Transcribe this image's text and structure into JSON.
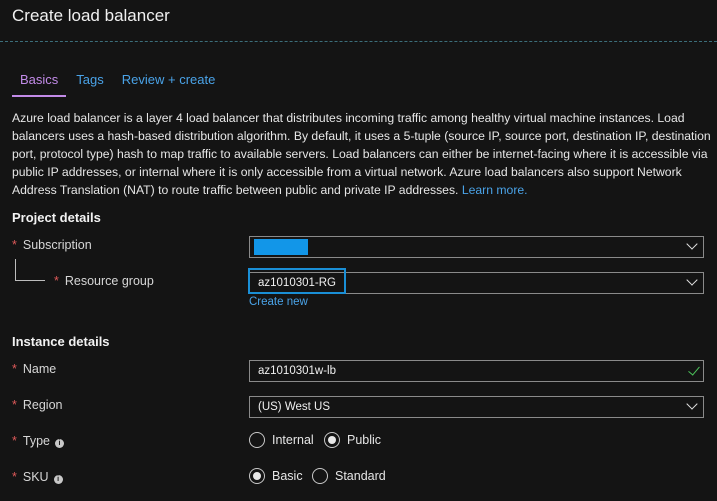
{
  "window": {
    "title": "Create load balancer"
  },
  "tabs": [
    {
      "label": "Basics",
      "active": true
    },
    {
      "label": "Tags",
      "active": false
    },
    {
      "label": "Review + create",
      "active": false
    }
  ],
  "description": {
    "text": "Azure load balancer is a layer 4 load balancer that distributes incoming traffic among healthy virtual machine instances. Load balancers uses a hash-based distribution algorithm. By default, it uses a 5-tuple (source IP, source port, destination IP, destination port, protocol type) hash to map traffic to available servers. Load balancers can either be internet-facing where it is accessible via public IP addresses, or internal where it is only accessible from a virtual network. Azure load balancers also support Network Address Translation (NAT) to route traffic between public and private IP addresses.",
    "link": "Learn more."
  },
  "project_details": {
    "heading": "Project details",
    "subscription": {
      "label": "Subscription",
      "required_mark": "*",
      "value": ""
    },
    "resource_group": {
      "label": "Resource group",
      "required_mark": "*",
      "value": "az1010301-RG",
      "create_new": "Create new"
    }
  },
  "instance_details": {
    "heading": "Instance details",
    "name": {
      "label": "Name",
      "required_mark": "*",
      "value": "az1010301w-lb"
    },
    "region": {
      "label": "Region",
      "required_mark": "*",
      "value": "(US) West US"
    },
    "type": {
      "label": "Type",
      "required_mark": "*",
      "info": "i",
      "options": [
        "Internal",
        "Public"
      ],
      "selected": "Public"
    },
    "sku": {
      "label": "SKU",
      "required_mark": "*",
      "info": "i",
      "options": [
        "Basic",
        "Standard"
      ],
      "selected": "Basic"
    }
  },
  "colors": {
    "accent": "#4aa3e8",
    "active_tab": "#c28be8",
    "required": "#e05a5a",
    "valid": "#4cc35b",
    "highlight": "#1a8fd6"
  }
}
